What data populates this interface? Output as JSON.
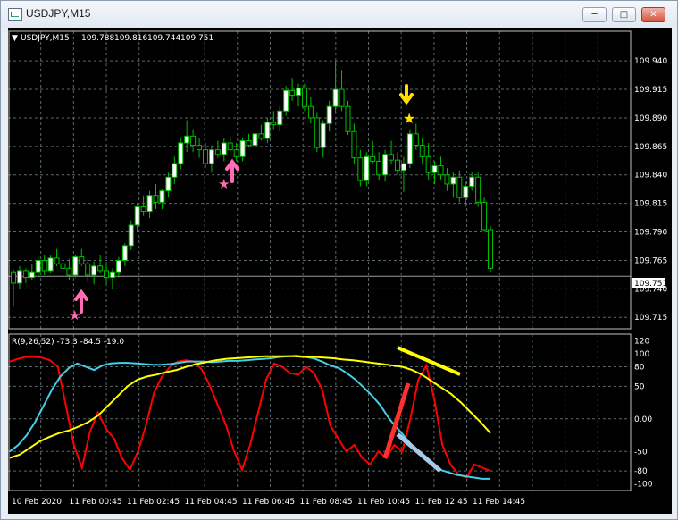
{
  "window": {
    "title": "USDJPY,M15"
  },
  "header": {
    "symbol": "USDJPY,M15",
    "open": "109.788",
    "high": "109.816",
    "low": "109.744",
    "close": "109.751"
  },
  "indicator": {
    "label": "R(9,26,52) -73.3 -84.5 -19.0"
  },
  "current_price": "109.751",
  "price_ticks": [
    "109.940",
    "109.915",
    "109.890",
    "109.865",
    "109.840",
    "109.815",
    "109.790",
    "109.765",
    "109.740",
    "109.715"
  ],
  "osc_ticks": [
    "120",
    "100",
    "80",
    "50",
    "0.00",
    "-50",
    "-80",
    "-100"
  ],
  "time_ticks": [
    "10 Feb 2020",
    "11 Feb 00:45",
    "11 Feb 02:45",
    "11 Feb 04:45",
    "11 Feb 06:45",
    "11 Feb 08:45",
    "11 Feb 10:45",
    "11 Feb 12:45",
    "11 Feb 14:45"
  ],
  "colors": {
    "bull": "#ffffff",
    "bear": "#000000",
    "wick": "#00c000",
    "red": "#ff0000",
    "cyan": "#40d0e8",
    "yellow": "#ffff00",
    "arrow_up": "#ff6eb4",
    "arrow_down": "#ffe000",
    "grid": "#5a6a6a"
  },
  "chart_data": [
    {
      "type": "candlestick",
      "symbol": "USDJPY",
      "timeframe": "M15",
      "ylim": [
        109.705,
        109.955
      ],
      "grid": true,
      "x_range": [
        "10 Feb 2020",
        "11 Feb 14:45"
      ],
      "candles": [
        [
          109.755,
          109.757,
          109.725,
          109.745
        ],
        [
          109.745,
          109.76,
          109.74,
          109.756
        ],
        [
          109.756,
          109.758,
          109.745,
          109.75
        ],
        [
          109.75,
          109.762,
          109.748,
          109.755
        ],
        [
          109.755,
          109.768,
          109.75,
          109.765
        ],
        [
          109.765,
          109.77,
          109.752,
          109.756
        ],
        [
          109.756,
          109.77,
          109.754,
          109.767
        ],
        [
          109.767,
          109.775,
          109.76,
          109.762
        ],
        [
          109.762,
          109.768,
          109.752,
          109.758
        ],
        [
          109.758,
          109.766,
          109.748,
          109.752
        ],
        [
          109.752,
          109.77,
          109.75,
          109.768
        ],
        [
          109.768,
          109.775,
          109.76,
          109.762
        ],
        [
          109.762,
          109.766,
          109.746,
          109.752
        ],
        [
          109.752,
          109.764,
          109.744,
          109.76
        ],
        [
          109.76,
          109.77,
          109.754,
          109.756
        ],
        [
          109.756,
          109.762,
          109.744,
          109.75
        ],
        [
          109.75,
          109.758,
          109.74,
          109.755
        ],
        [
          109.755,
          109.768,
          109.75,
          109.765
        ],
        [
          109.765,
          109.78,
          109.76,
          109.778
        ],
        [
          109.778,
          109.8,
          109.774,
          109.796
        ],
        [
          109.796,
          109.815,
          109.79,
          109.812
        ],
        [
          109.812,
          109.822,
          109.804,
          109.808
        ],
        [
          109.808,
          109.826,
          109.802,
          109.822
        ],
        [
          109.822,
          109.832,
          109.81,
          109.816
        ],
        [
          109.816,
          109.828,
          109.81,
          109.826
        ],
        [
          109.826,
          109.842,
          109.82,
          109.838
        ],
        [
          109.838,
          109.856,
          109.832,
          109.85
        ],
        [
          109.85,
          109.872,
          109.845,
          109.868
        ],
        [
          109.868,
          109.888,
          109.86,
          109.874
        ],
        [
          109.874,
          109.88,
          109.86,
          109.866
        ],
        [
          109.866,
          109.872,
          109.855,
          109.862
        ],
        [
          109.862,
          109.868,
          109.846,
          109.85
        ],
        [
          109.85,
          109.866,
          109.842,
          109.862
        ],
        [
          109.862,
          109.87,
          109.855,
          109.858
        ],
        [
          109.858,
          109.872,
          109.852,
          109.868
        ],
        [
          109.868,
          109.874,
          109.86,
          109.862
        ],
        [
          109.862,
          109.868,
          109.852,
          109.856
        ],
        [
          109.856,
          109.872,
          109.852,
          109.87
        ],
        [
          109.87,
          109.876,
          109.864,
          109.866
        ],
        [
          109.866,
          109.88,
          109.862,
          109.876
        ],
        [
          109.876,
          109.884,
          109.87,
          109.872
        ],
        [
          109.872,
          109.89,
          109.868,
          109.886
        ],
        [
          109.886,
          109.896,
          109.88,
          109.884
        ],
        [
          109.884,
          109.9,
          109.878,
          109.896
        ],
        [
          109.896,
          109.918,
          109.892,
          109.914
        ],
        [
          109.914,
          109.925,
          109.905,
          109.91
        ],
        [
          109.91,
          109.92,
          109.9,
          109.916
        ],
        [
          109.916,
          109.92,
          109.896,
          109.9
        ],
        [
          109.9,
          109.908,
          109.885,
          109.89
        ],
        [
          109.89,
          109.895,
          109.86,
          109.864
        ],
        [
          109.864,
          109.888,
          109.855,
          109.885
        ],
        [
          109.885,
          109.905,
          109.878,
          109.9
        ],
        [
          109.9,
          109.94,
          109.895,
          109.915
        ],
        [
          109.915,
          109.932,
          109.896,
          109.9
        ],
        [
          109.9,
          109.905,
          109.875,
          109.878
        ],
        [
          109.878,
          109.885,
          109.85,
          109.855
        ],
        [
          109.855,
          109.862,
          109.83,
          109.835
        ],
        [
          109.835,
          109.86,
          109.83,
          109.856
        ],
        [
          109.856,
          109.87,
          109.85,
          109.852
        ],
        [
          109.852,
          109.86,
          109.835,
          109.84
        ],
        [
          109.84,
          109.862,
          109.834,
          109.858
        ],
        [
          109.858,
          109.87,
          109.85,
          109.853
        ],
        [
          109.853,
          109.86,
          109.84,
          109.844
        ],
        [
          109.844,
          109.856,
          109.825,
          109.85
        ],
        [
          109.85,
          109.88,
          109.846,
          109.876
        ],
        [
          109.876,
          109.885,
          109.862,
          109.866
        ],
        [
          109.866,
          109.872,
          109.85,
          109.856
        ],
        [
          109.856,
          109.868,
          109.836,
          109.842
        ],
        [
          109.842,
          109.852,
          109.832,
          109.848
        ],
        [
          109.848,
          109.856,
          109.836,
          109.84
        ],
        [
          109.84,
          109.846,
          109.826,
          109.832
        ],
        [
          109.832,
          109.842,
          109.82,
          109.838
        ],
        [
          109.838,
          109.844,
          109.816,
          109.82
        ],
        [
          109.82,
          109.834,
          109.812,
          109.83
        ],
        [
          109.83,
          109.842,
          109.826,
          109.838
        ],
        [
          109.838,
          109.842,
          109.812,
          109.816
        ],
        [
          109.816,
          109.82,
          109.79,
          109.792
        ],
        [
          109.792,
          109.795,
          109.755,
          109.758
        ]
      ]
    },
    {
      "type": "line",
      "label": "R(9,26,52) -73.3 -84.5 -19.0",
      "ylim": [
        -110,
        130
      ],
      "yticks": [
        120,
        100,
        80,
        50,
        0,
        -50,
        -80,
        -100
      ],
      "series": [
        {
          "color": "#ff0000",
          "values": [
            88,
            92,
            95,
            95,
            94,
            90,
            80,
            20,
            -40,
            -75,
            -20,
            10,
            -15,
            -30,
            -60,
            -78,
            -50,
            -10,
            40,
            65,
            80,
            88,
            90,
            88,
            75,
            50,
            20,
            -10,
            -50,
            -78,
            -40,
            10,
            60,
            85,
            80,
            70,
            68,
            80,
            70,
            45,
            -10,
            -30,
            -50,
            -40,
            -60,
            -70,
            -50,
            -60,
            -40,
            -50,
            0,
            60,
            82,
            30,
            -40,
            -70,
            -85,
            -90,
            -70,
            -75,
            -80
          ]
        },
        {
          "color": "#40d0e8",
          "values": [
            -50,
            -40,
            -25,
            -5,
            20,
            45,
            65,
            78,
            85,
            80,
            75,
            82,
            85,
            86,
            86,
            85,
            84,
            83,
            83,
            84,
            86,
            88,
            88,
            88,
            87,
            88,
            89,
            89,
            90,
            91,
            92,
            93,
            95,
            96,
            97,
            95,
            93,
            88,
            82,
            78,
            70,
            60,
            48,
            35,
            20,
            0,
            -15,
            -30,
            -45,
            -60,
            -70,
            -78,
            -82,
            -86,
            -88,
            -90,
            -92,
            -92
          ]
        },
        {
          "color": "#ffff00",
          "values": [
            -60,
            -55,
            -45,
            -35,
            -28,
            -22,
            -18,
            -12,
            -5,
            5,
            20,
            35,
            50,
            60,
            65,
            68,
            72,
            75,
            80,
            84,
            87,
            90,
            92,
            93,
            94,
            95,
            96,
            96,
            96,
            96,
            95,
            95,
            94,
            93,
            91,
            90,
            88,
            86,
            84,
            82,
            80,
            75,
            68,
            58,
            48,
            38,
            25,
            10,
            -5,
            -22
          ]
        }
      ]
    }
  ]
}
